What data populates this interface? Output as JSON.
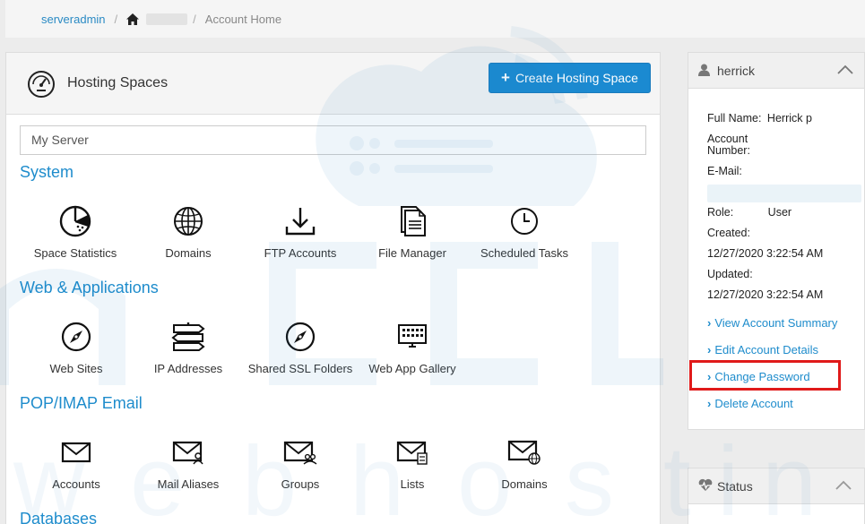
{
  "breadcrumb": {
    "root": "serveradmin",
    "current": "Account Home"
  },
  "hosting": {
    "title": "Hosting Spaces",
    "create_button": "Create Hosting Space",
    "server_value": "My Server"
  },
  "sections": {
    "system": {
      "title": "System",
      "items": [
        "Space Statistics",
        "Domains",
        "FTP Accounts",
        "File Manager",
        "Scheduled Tasks"
      ]
    },
    "web": {
      "title": "Web & Applications",
      "items": [
        "Web Sites",
        "IP Addresses",
        "Shared SSL Folders",
        "Web App Gallery"
      ]
    },
    "email": {
      "title": "POP/IMAP Email",
      "items": [
        "Accounts",
        "Mail Aliases",
        "Groups",
        "Lists",
        "Domains"
      ]
    },
    "databases": {
      "title": "Databases"
    }
  },
  "account": {
    "username": "herrick",
    "full_name_label": "Full Name:",
    "full_name": "Herrick p",
    "account_number_label": "Account Number:",
    "email_label": "E-Mail:",
    "role_label": "Role:",
    "role": "User",
    "created_label": "Created:",
    "created": "12/27/2020 3:22:54 AM",
    "updated_label": "Updated:",
    "updated": "12/27/2020 3:22:54 AM",
    "links": [
      "View Account Summary",
      "Edit Account Details",
      "Change Password",
      "Delete Account"
    ]
  },
  "status_panel": {
    "title": "Status"
  },
  "colors": {
    "accent": "#1e8ccc",
    "button": "#1b8ad1",
    "highlight": "#e01a1a"
  }
}
